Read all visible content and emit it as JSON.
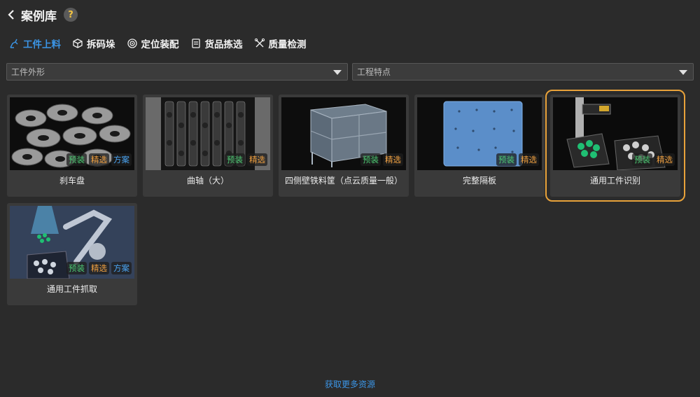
{
  "header": {
    "title": "案例库",
    "help": "?"
  },
  "tabs": [
    {
      "label": "工件上料",
      "icon": "workpiece-loading-icon"
    },
    {
      "label": "拆码垛",
      "icon": "box-icon"
    },
    {
      "label": "定位装配",
      "icon": "target-icon"
    },
    {
      "label": "货品拣选",
      "icon": "goods-icon"
    },
    {
      "label": "质量检测",
      "icon": "inspection-icon"
    }
  ],
  "filters": [
    {
      "placeholder": "工件外形"
    },
    {
      "placeholder": "工程特点"
    }
  ],
  "badge_labels": {
    "preinstalled": "预装",
    "featured": "精选",
    "solution": "方案"
  },
  "cards": [
    {
      "label": "刹车盘"
    },
    {
      "label": "曲轴（大）"
    },
    {
      "label": "四侧壁铁料筐（点云质量一般）"
    },
    {
      "label": "完整隔板"
    },
    {
      "label": "通用工件识别"
    },
    {
      "label": "通用工件抓取"
    }
  ],
  "footer": {
    "link": "获取更多资源"
  },
  "colors": {
    "accent": "#3b95e6",
    "selected_border": "#e8a23a",
    "badge_green": "#4ecb74",
    "badge_orange": "#f0a040",
    "badge_blue": "#4aa3f0"
  }
}
